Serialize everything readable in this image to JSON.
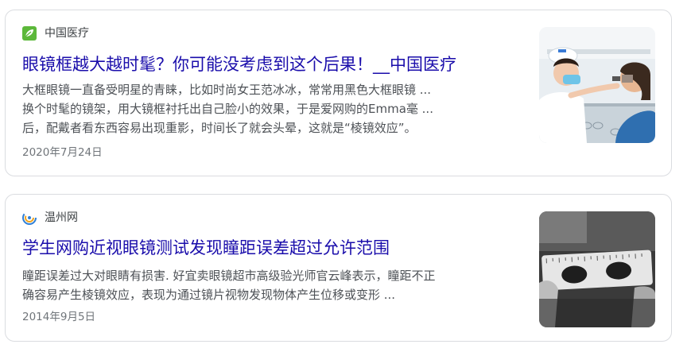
{
  "results": [
    {
      "source_name": "中国医疗",
      "source_icon": "leaf-logo-icon",
      "title": "眼镜框越大越时髦？你可能没考虑到这个后果！__中国医疗",
      "snippet_lines": [
        "大框眼镜一直备受明星的青睐，比如时尚女王范冰冰，常常用黑色大框眼镜 ...",
        "换个时髦的镜架，用大镜框衬托出自己脸小的效果，于是爱网购的Emma毫 ...",
        "后，配戴者看东西容易出现重影，时间长了就会头晕，这就是“棱镜效应”。"
      ],
      "date": "2020年7月24日",
      "thumbnail": "optometrist-examining-patient-image"
    },
    {
      "source_name": "温州网",
      "source_icon": "swirl-logo-icon",
      "title": "学生网购近视眼镜测试发现瞳距误差超过允许范围",
      "snippet_lines": [
        "瞳距误差过大对眼睛有损害. 好宜卖眼镜超市高级验光师官云峰表示，瞳距不正",
        "确容易产生棱镜效应，表现为通过镜片视物发现物体产生位移或变形 ..."
      ],
      "date": "2014年9月5日",
      "thumbnail": "pupil-distance-ruler-image"
    }
  ],
  "colors": {
    "title_link": "#1a0dab",
    "snippet": "#4d5156",
    "date": "#70757a",
    "border": "#dadce0"
  }
}
